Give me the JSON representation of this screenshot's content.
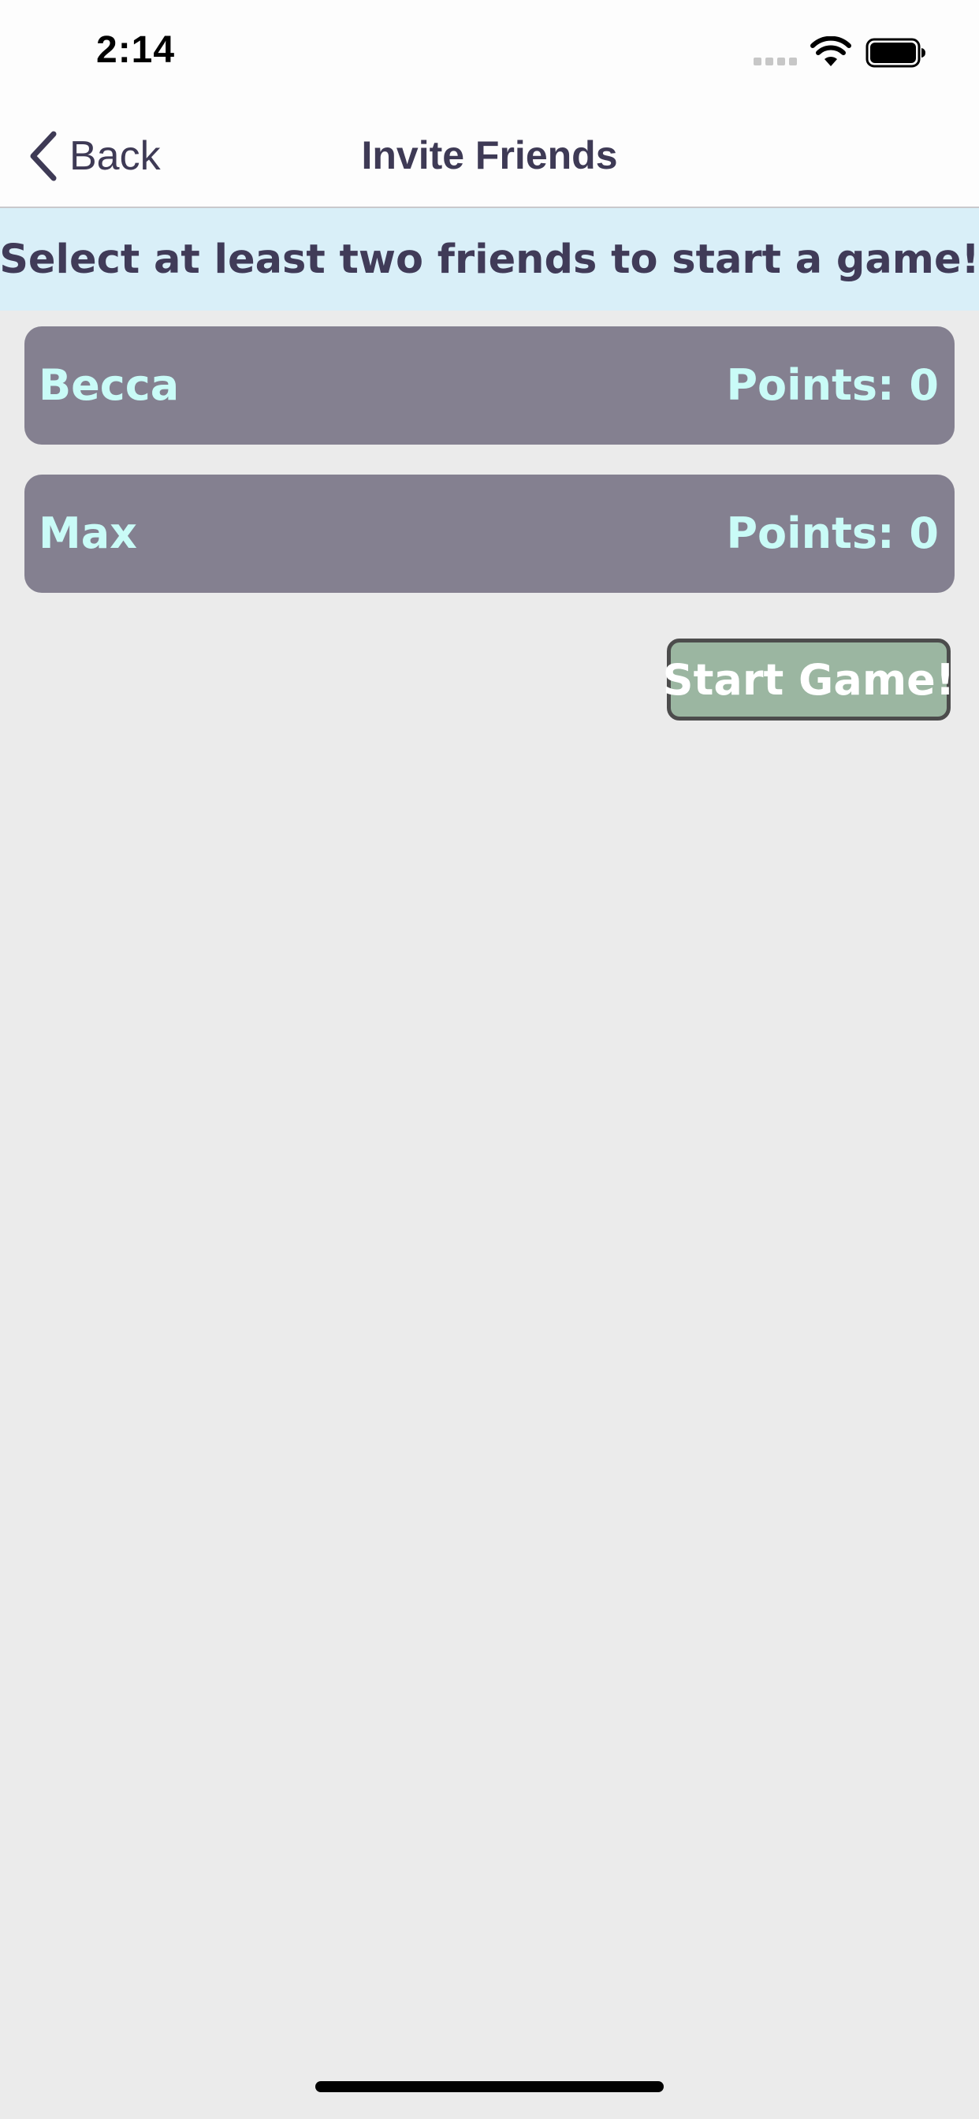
{
  "status_bar": {
    "time": "2:14"
  },
  "nav": {
    "back_label": "Back",
    "title": "Invite Friends"
  },
  "banner": {
    "text": "Select at least two friends to start a game!"
  },
  "friends": [
    {
      "name": "Becca",
      "points_label": "Points: 0"
    },
    {
      "name": "Max",
      "points_label": "Points: 0"
    }
  ],
  "actions": {
    "start_label": "Start Game!"
  },
  "colors": {
    "background": "#ebebeb",
    "banner_background": "#d9eff8",
    "card_background": "#848090",
    "card_text": "#c9fbf7",
    "start_button": "#9bb6a1",
    "title_text": "#3e3a55"
  }
}
